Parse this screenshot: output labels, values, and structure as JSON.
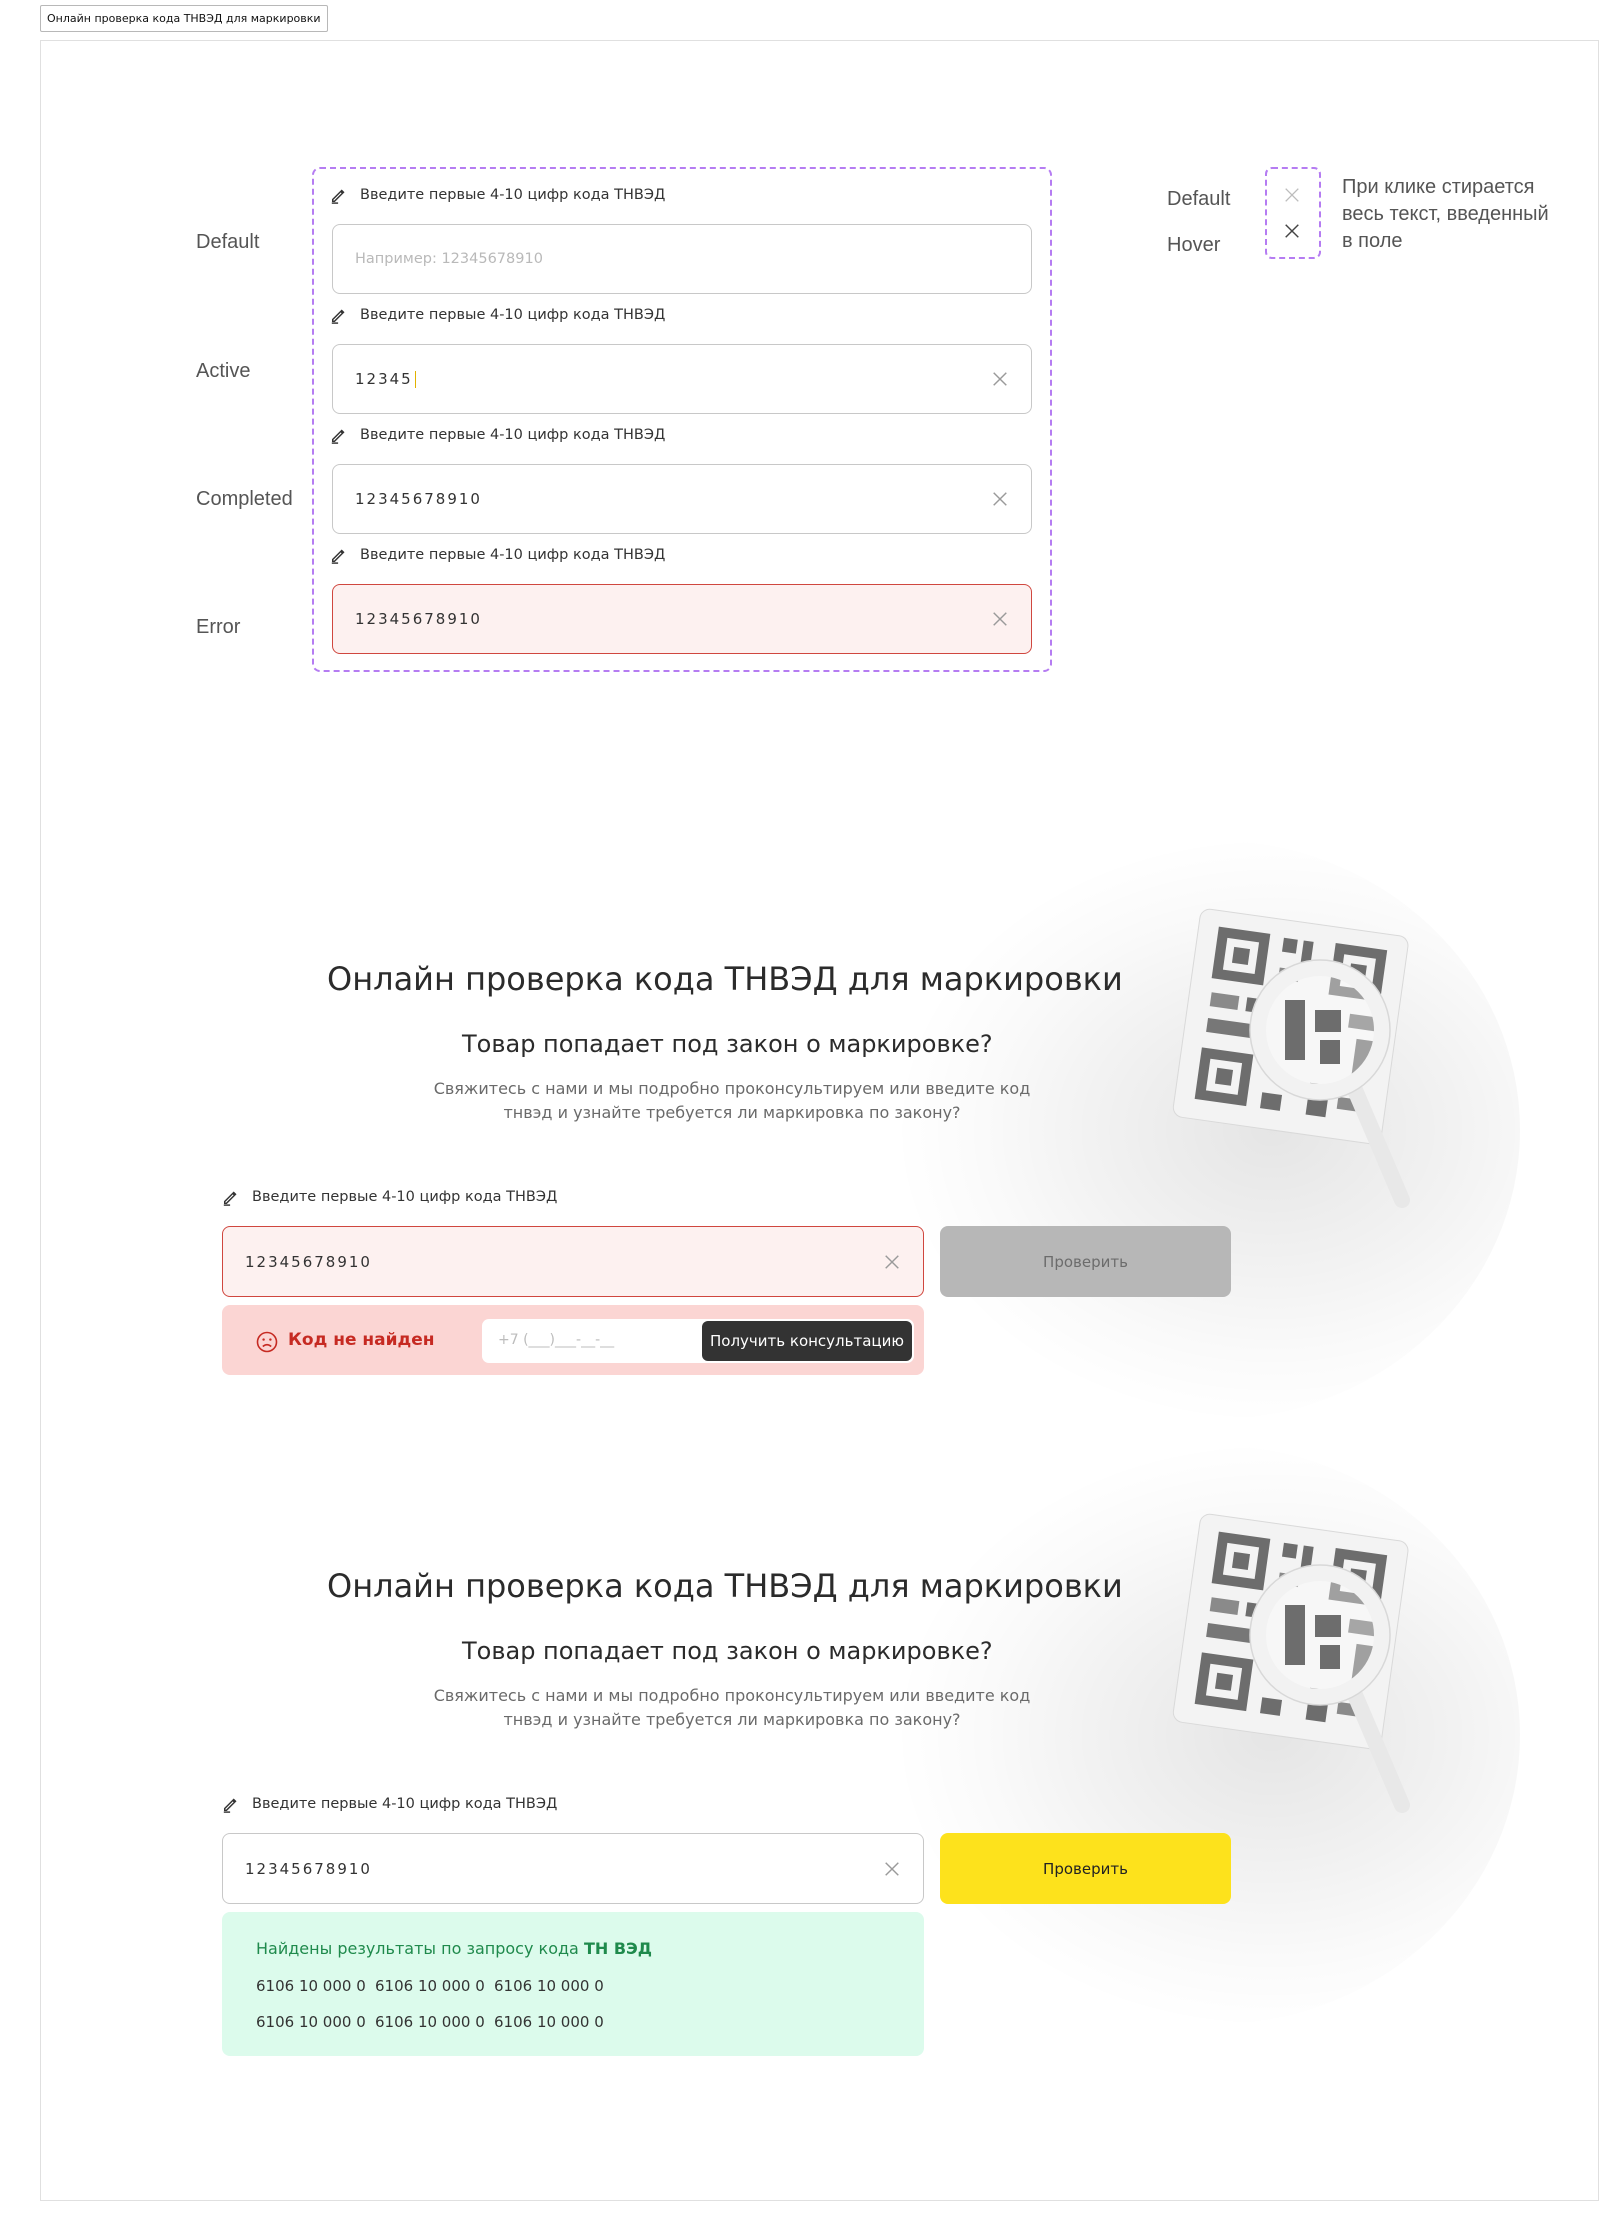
{
  "page_tag": "Онлайн проверка кода ТНВЭД для маркировки",
  "states": {
    "default": "Default",
    "active": "Active",
    "completed": "Completed",
    "error": "Error"
  },
  "field": {
    "label": "Введите первые 4-10 цифр кода ТНВЭД",
    "placeholder": "Например: 12345678910",
    "active_value": "12345",
    "completed_value": "12345678910",
    "error_value": "12345678910"
  },
  "clear_icon_demo": {
    "default_label": "Default",
    "hover_label": "Hover",
    "note": "При клике стирается весь текст, введенный в поле"
  },
  "hero_error": {
    "title": "Онлайн проверка кода ТНВЭД для маркировки",
    "subtitle": "Товар попадает под закон о маркировке?",
    "description": "Свяжитесь с нами и мы подробно проконсультируем или введите код тнвэд и узнайте требуется ли маркировка по закону?",
    "field_label": "Введите первые 4-10 цифр кода ТНВЭД",
    "value": "12345678910",
    "button": "Проверить",
    "not_found": "Код не найден",
    "phone_placeholder": "+7 (___)___-__-__",
    "consult_button": "Получить консультацию"
  },
  "hero_success": {
    "title": "Онлайн проверка кода ТНВЭД для маркировки",
    "subtitle": "Товар попадает под закон о маркировке?",
    "description": "Свяжитесь с нами и мы подробно проконсультируем или введите код тнвэд и узнайте требуется ли маркировка по закону?",
    "field_label": "Введите первые 4-10 цифр кода ТНВЭД",
    "value": "12345678910",
    "button": "Проверить",
    "results_prefix": "Найдены результаты по запросу кода ",
    "results_code": "ТН ВЭД",
    "codes": [
      "6106 10 000 0",
      "6106 10 000 0",
      "6106 10 000 0",
      "6106 10 000 0",
      "6106 10 000 0",
      "6106 10 000 0"
    ]
  },
  "colors": {
    "dashed_frame": "#b57cf2",
    "error_border": "#d0473f",
    "error_text": "#c62a22",
    "success_text": "#1f8a4c",
    "primary_button": "#fde21c",
    "disabled_button": "#b7b7b7",
    "dark_button": "#333333"
  },
  "icons": [
    "pencil-icon",
    "close-icon",
    "sad-face-icon",
    "qr-magnifier-illustration"
  ]
}
